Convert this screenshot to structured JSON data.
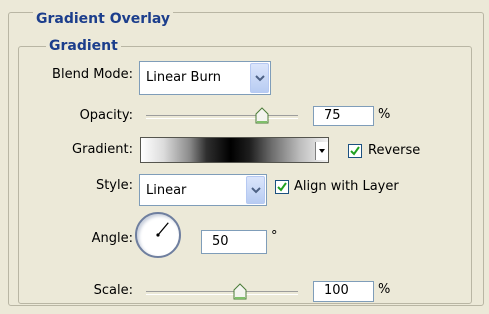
{
  "panel": {
    "section_title": "Gradient Overlay",
    "group_title": "Gradient"
  },
  "blend_mode": {
    "label": "Blend Mode:",
    "value": "Linear Burn",
    "icon": "chevron-down-icon"
  },
  "opacity": {
    "label": "Opacity:",
    "value": "75",
    "unit": "%",
    "slider_fraction": 0.75
  },
  "gradient": {
    "label": "Gradient:",
    "reverse_label": "Reverse",
    "reverse_checked": true,
    "icon": "triangle-down-icon"
  },
  "style": {
    "label": "Style:",
    "value": "Linear",
    "align_label": "Align with Layer",
    "align_checked": true,
    "icon": "chevron-down-icon"
  },
  "angle": {
    "label": "Angle:",
    "value": "50",
    "unit": "°",
    "degrees": 50
  },
  "scale": {
    "label": "Scale:",
    "value": "100",
    "unit": "%"
  },
  "colors": {
    "legend": "#1c3e8c",
    "background": "#ece9d8",
    "accent": "#316ac5"
  }
}
